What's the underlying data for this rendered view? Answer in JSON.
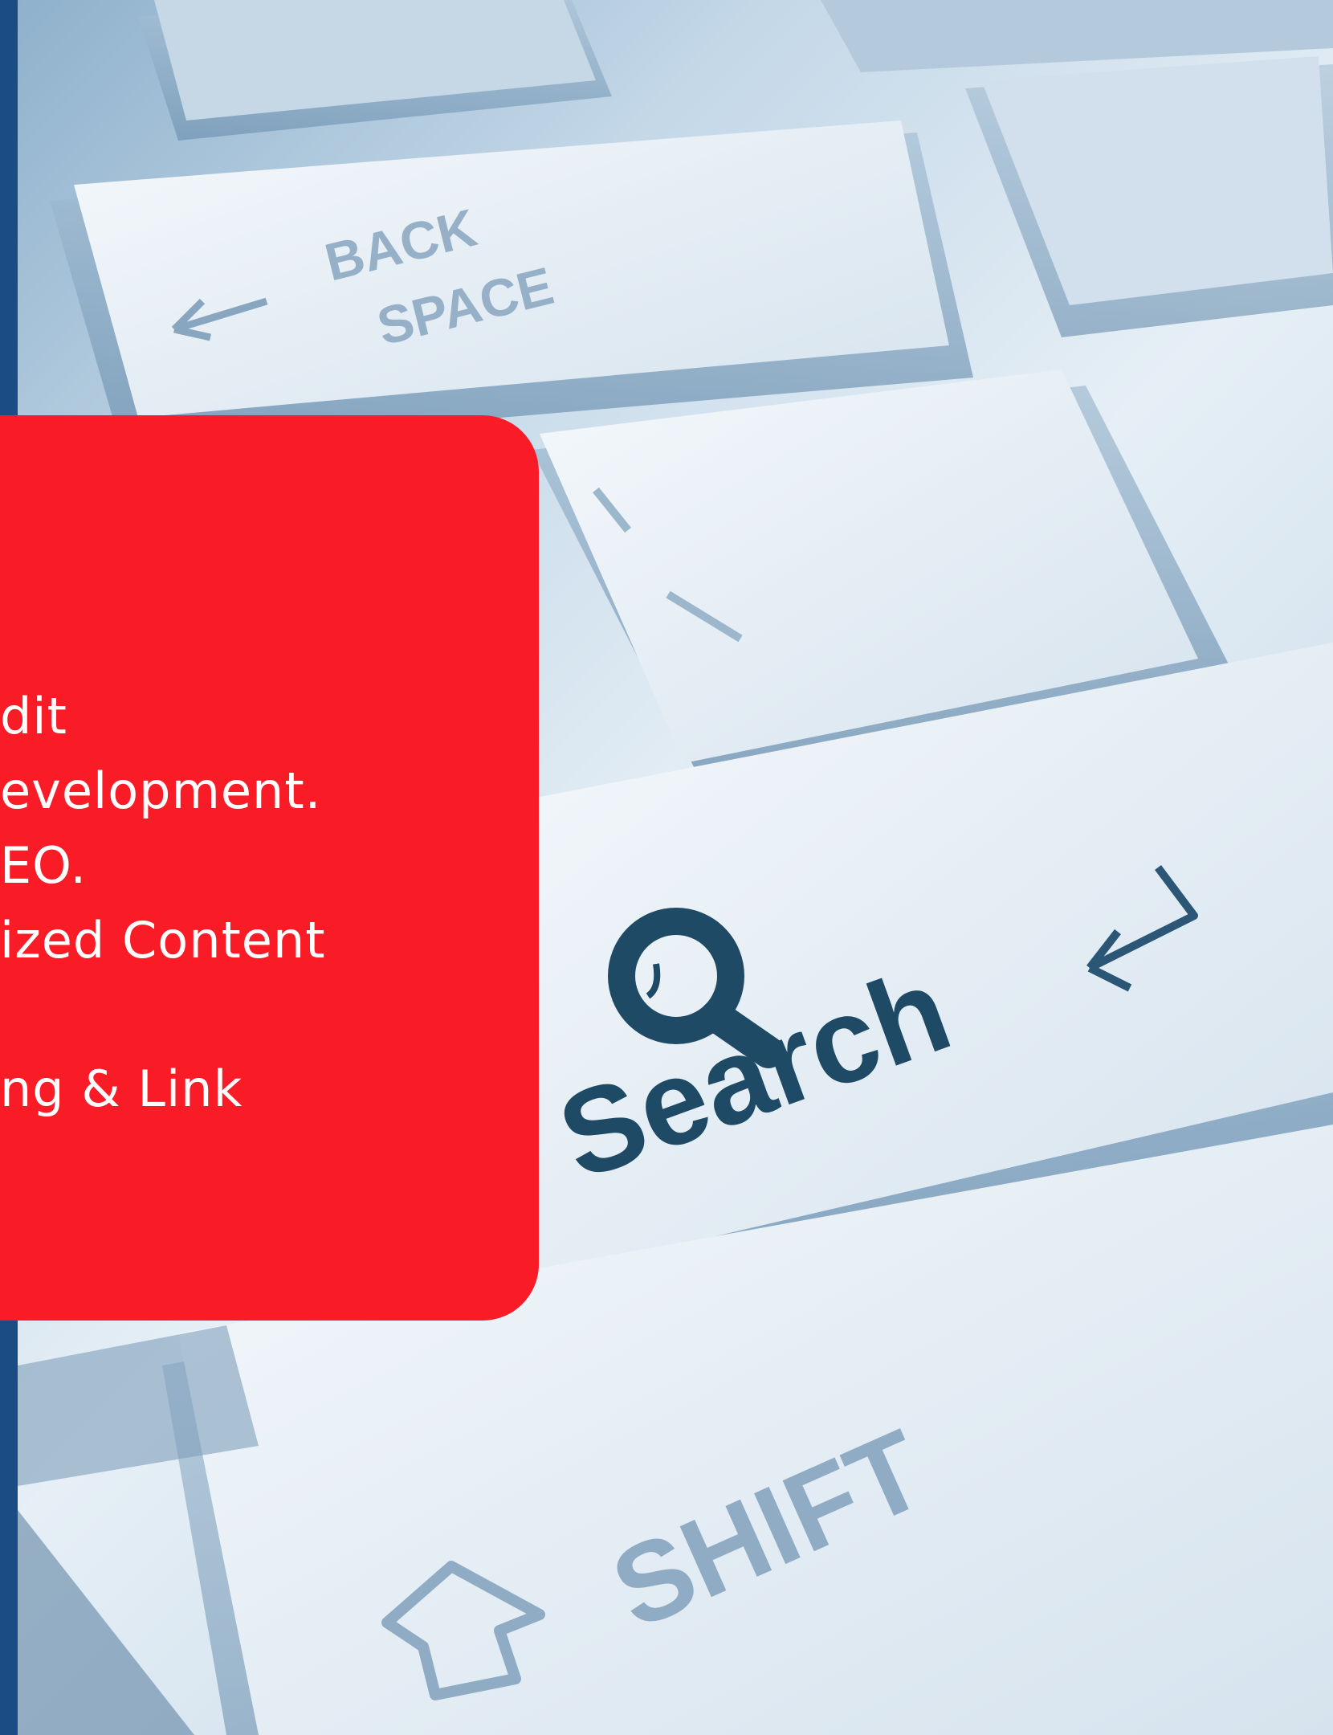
{
  "panel": {
    "lines": [
      "dit",
      "evelopment.",
      "EO.",
      "ized Content",
      "ng & Link"
    ]
  },
  "keys": {
    "backspace_line1": "BACK",
    "backspace_line2": "SPACE",
    "search_label": "Search",
    "shift_label": "SHIFT"
  },
  "colors": {
    "stripe": "#1b4c84",
    "panel": "#f91c26",
    "key_ink": "#1f4a66"
  },
  "icons": [
    "magnifier-icon",
    "enter-arrow-icon",
    "shift-arrow-icon",
    "backspace-arrow-icon"
  ]
}
